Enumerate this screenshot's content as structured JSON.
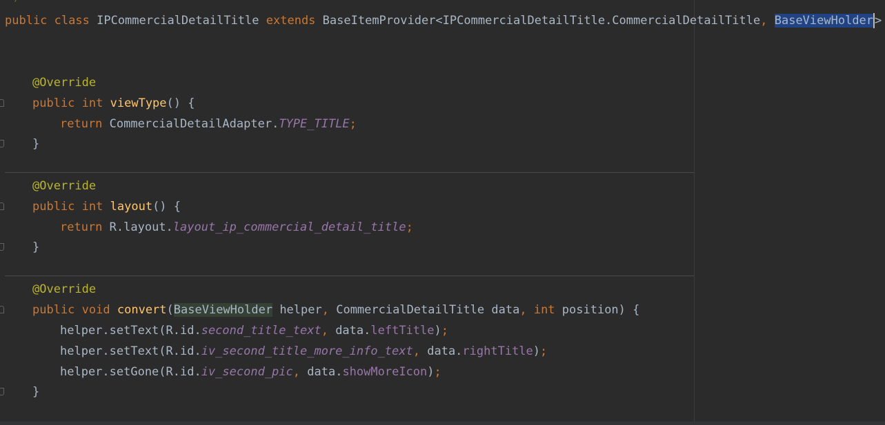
{
  "editor": {
    "top_fragment": "\"/",
    "class_decl": {
      "kw_public": "public",
      "kw_class": "class",
      "class_name": "IPCommercialDetailTitle",
      "kw_extends": "extends",
      "base": "BaseItemProvider<IPCommercialDetailTitle.CommercialDetailTitle",
      "comma": ",",
      "selected_type": "BaseViewHolder",
      "tail": "> {"
    },
    "method1": {
      "annotation": "@Override",
      "kw_public": "public",
      "kw_type": "int",
      "name": "viewType",
      "sig_rest": "() {",
      "kw_return": "return",
      "expr": "CommercialDetailAdapter.",
      "constant": "TYPE_TITLE",
      "semi": ";",
      "close": "}"
    },
    "method2": {
      "annotation": "@Override",
      "kw_public": "public",
      "kw_type": "int",
      "name": "layout",
      "sig_rest": "() {",
      "kw_return": "return",
      "expr": "R.layout.",
      "constant": "layout_ip_commercial_detail_title",
      "semi": ";",
      "close": "}"
    },
    "method3": {
      "annotation": "@Override",
      "kw_public": "public",
      "kw_void": "void",
      "name": "convert",
      "paren_open": "(",
      "param1_type": "BaseViewHolder",
      "param1_name": " helper",
      "comma": ",",
      "param2": " CommercialDetailTitle data",
      "kw_int": "int",
      "param3_rest": " position) {",
      "stmt1": {
        "call": "helper.setText(R.id.",
        "id": "second_title_text",
        "comma": ",",
        "arg": " data.",
        "field": "leftTitle",
        "end_paren": ")",
        "semi": ";"
      },
      "stmt2": {
        "call": "helper.setText(R.id.",
        "id": "iv_second_title_more_info_text",
        "comma": ",",
        "arg": " data.",
        "field": "rightTitle",
        "end_paren": ")",
        "semi": ";"
      },
      "stmt3": {
        "call": "helper.setGone(R.id.",
        "id": "iv_second_pic",
        "comma": ",",
        "arg": " data.",
        "field": "showMoreIcon",
        "end_paren": ")",
        "semi": ";"
      },
      "close": "}"
    }
  },
  "colors": {
    "background": "#2b2b2b",
    "keyword": "#cc7832",
    "annotation": "#bbb529",
    "method": "#ffc66d",
    "constant": "#9876aa",
    "text": "#a9b7c6",
    "selection": "#214283"
  }
}
